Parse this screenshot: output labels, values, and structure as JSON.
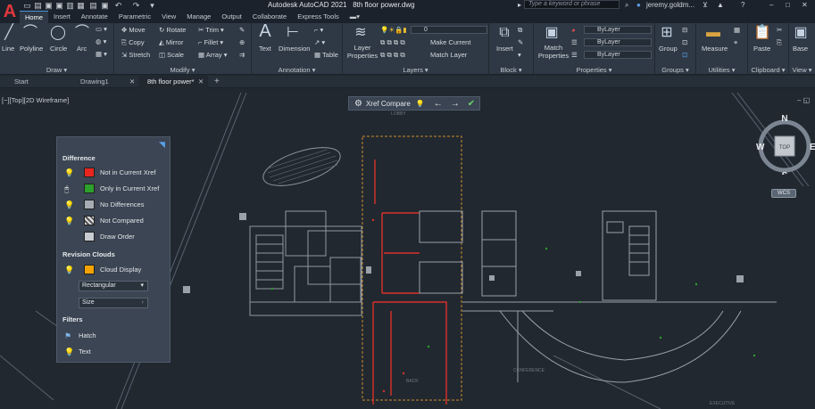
{
  "app": {
    "logo": "A",
    "title": "Autodesk AutoCAD 2021",
    "filename": "8th floor power.dwg",
    "search_placeholder": "Type a keyword or phrase",
    "user": "jeremy.goldm...",
    "quick_access_icons": [
      "new-icon",
      "open-icon",
      "save-icon",
      "saveas-icon",
      "plot-icon",
      "print-icon",
      "undo-icon",
      "redo-icon",
      "more-icon"
    ]
  },
  "ribbon_tabs": [
    "Home",
    "Insert",
    "Annotate",
    "Parametric",
    "View",
    "Manage",
    "Output",
    "Collaborate",
    "Express Tools"
  ],
  "ribbon": {
    "draw": {
      "title": "Draw",
      "line": "Line",
      "polyline": "Polyline",
      "circle": "Circle",
      "arc": "Arc"
    },
    "modify": {
      "title": "Modify",
      "move": "Move",
      "rotate": "Rotate",
      "trim": "Trim",
      "copy": "Copy",
      "mirror": "Mirror",
      "fillet": "Fillet",
      "stretch": "Stretch",
      "scale": "Scale",
      "array": "Array"
    },
    "annotation": {
      "title": "Annotation",
      "text": "Text",
      "dimension": "Dimension",
      "table": "Table"
    },
    "layers": {
      "title": "Layers",
      "layer_properties": "Layer Properties",
      "current_layer": "0",
      "make_current": "Make Current",
      "match_layer": "Match Layer"
    },
    "block": {
      "title": "Block",
      "insert": "Insert"
    },
    "properties": {
      "title": "Properties",
      "match_properties": "Match Properties",
      "bylayer1": "ByLayer",
      "bylayer2": "ByLayer",
      "bylayer3": "ByLayer"
    },
    "groups": {
      "title": "Groups",
      "group": "Group"
    },
    "utilities": {
      "title": "Utilities",
      "measure": "Measure"
    },
    "clipboard": {
      "title": "Clipboard",
      "paste": "Paste"
    },
    "view": {
      "title": "View",
      "base": "Base"
    }
  },
  "doc_tabs": {
    "start": "Start",
    "drawing1": "Drawing1",
    "floor": "8th floor power*"
  },
  "viewport_label": "[−][Top][2D Wireframe]",
  "xref_toolbar": {
    "label": "Xref Compare"
  },
  "palette": {
    "difference_title": "Difference",
    "not_in_current": "Not in Current Xref",
    "only_in_current": "Only in Current Xref",
    "no_differences": "No Differences",
    "not_compared": "Not Compared",
    "draw_order": "Draw Order",
    "revision_title": "Revision Clouds",
    "cloud_display": "Cloud Display",
    "shape_selected": "Rectangular",
    "size_label": "Size",
    "filters_title": "Filters",
    "hatch": "Hatch",
    "text": "Text"
  },
  "colors": {
    "not_in_current": "#e8251f",
    "only_in_current": "#2ca02c",
    "no_differences": "#a6acb3",
    "cloud": "#f5a300",
    "accent": "#4a90d9",
    "xref_compare_red": "#d9302a",
    "xref_outline": "#d08b2a"
  },
  "viewcube": {
    "n": "N",
    "s": "S",
    "e": "E",
    "w": "W",
    "top": "TOP"
  },
  "wcs": "WCS"
}
